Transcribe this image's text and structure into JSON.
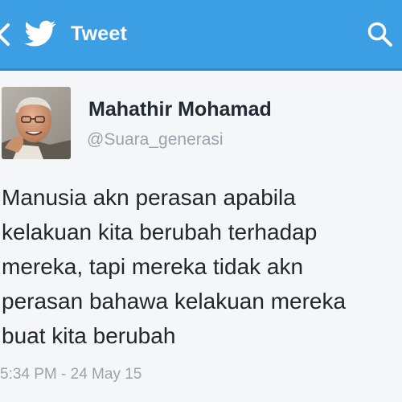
{
  "header": {
    "title": "Tweet",
    "back_icon": "chevron-left-icon",
    "logo_icon": "twitter-bird-icon",
    "search_icon": "search-icon",
    "background_color": "#3d9fe3"
  },
  "tweet": {
    "author_name": "Mahathir Mohamad",
    "author_handle": "@Suara_generasi",
    "text_lines": [
      "Manusia akn perasan apabila",
      "kelakuan kita berubah terhadap",
      "mereka, tapi mereka tidak akn",
      "perasan bahawa kelakuan mereka",
      "buat kita berubah"
    ],
    "timestamp": "5:34 PM - 24 May 15"
  }
}
